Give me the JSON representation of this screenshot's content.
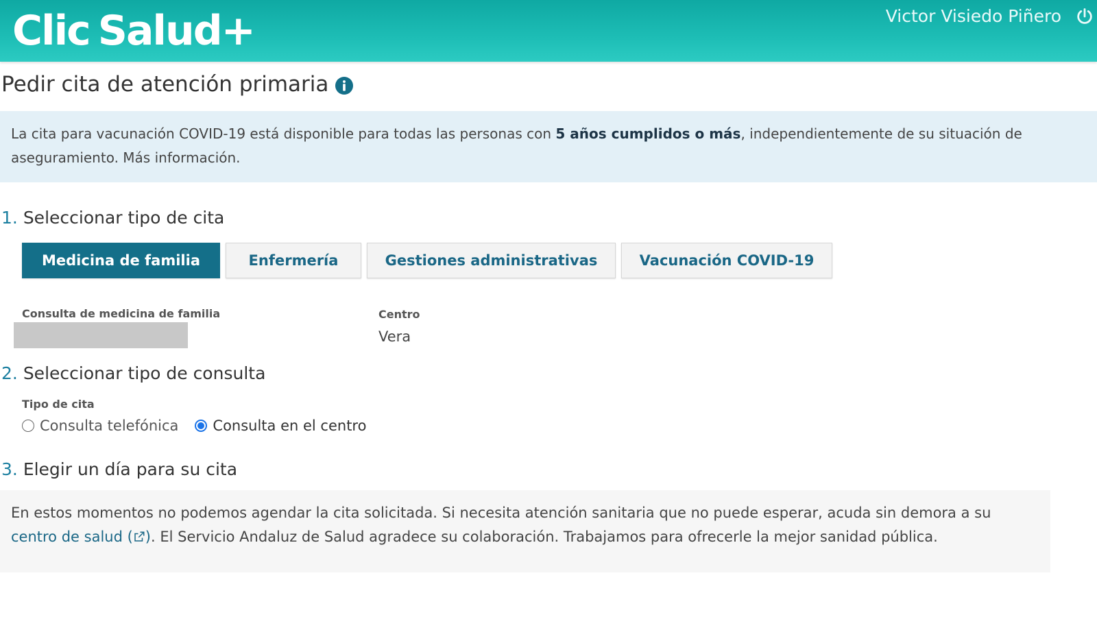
{
  "header": {
    "logo_left": "Clic",
    "logo_right": "Salud+",
    "user_name": "Victor Visiedo Piñero",
    "brand_color": "#1dbdb5"
  },
  "page": {
    "title": "Pedir cita de atención primaria",
    "info_icon": "info-icon"
  },
  "banner": {
    "text_before": "La cita para vacunación COVID-19 está disponible para todas las personas con ",
    "text_bold": "5 años cumplidos o más",
    "text_after": ", independientemente de su situación de aseguramiento. Más información."
  },
  "step1": {
    "number": "1.",
    "title": "Seleccionar tipo de cita",
    "tabs": [
      {
        "label": "Medicina de familia",
        "active": true
      },
      {
        "label": "Enfermería",
        "active": false
      },
      {
        "label": "Gestiones administrativas",
        "active": false
      },
      {
        "label": "Vacunación COVID-19",
        "active": false
      }
    ],
    "consulta_label": "Consulta de medicina de familia",
    "centro_label": "Centro",
    "centro_value": "Vera"
  },
  "step2": {
    "number": "2.",
    "title": "Seleccionar tipo de consulta",
    "field_label": "Tipo de cita",
    "options": [
      {
        "label": "Consulta telefónica",
        "selected": false
      },
      {
        "label": "Consulta en el centro",
        "selected": true
      }
    ]
  },
  "step3": {
    "number": "3.",
    "title": "Elegir un día para su cita",
    "notice_before": "En estos momentos no podemos agendar la cita solicitada. Si necesita atención sanitaria que no puede esperar, acuda sin demora a su ",
    "notice_link": "centro de salud (",
    "notice_link_close": ")",
    "notice_after": ". El Servicio Andaluz de Salud agradece su colaboración. Trabajamos para ofrecerle la mejor sanidad pública."
  }
}
